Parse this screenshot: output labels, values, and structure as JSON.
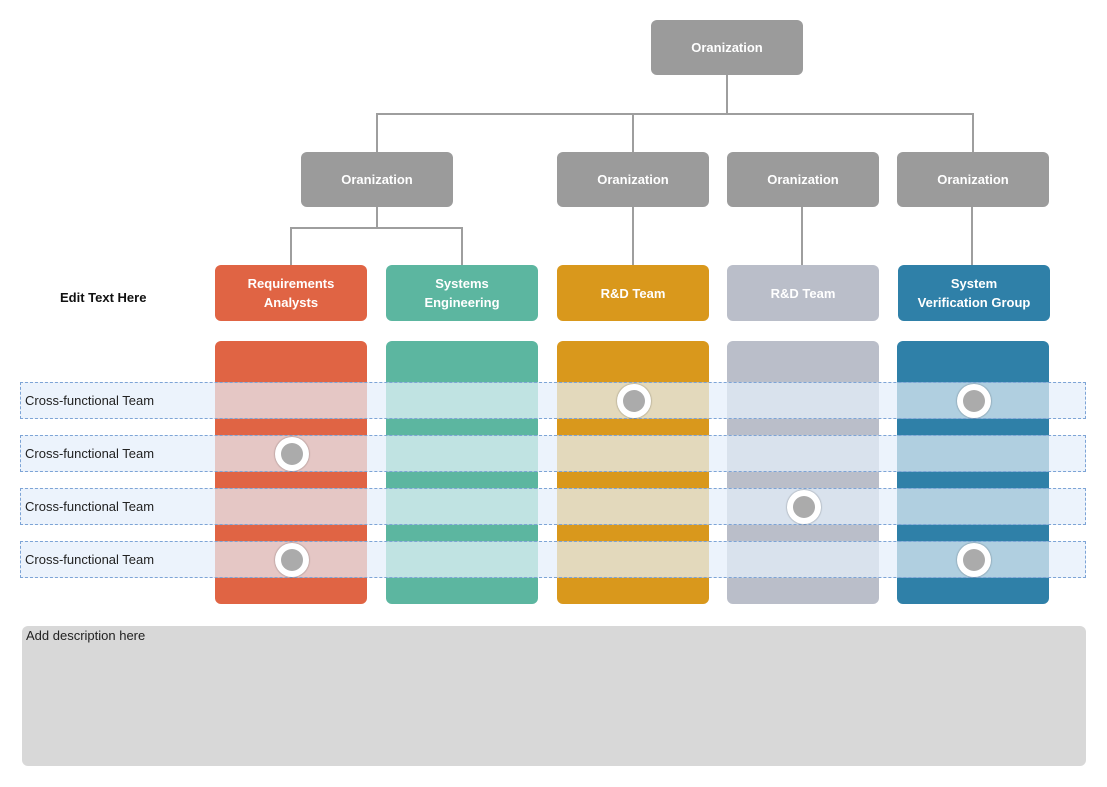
{
  "root": {
    "label": "Oranization"
  },
  "level2": [
    {
      "label": "Oranization"
    },
    {
      "label": "Oranization"
    },
    {
      "label": "Oranization"
    },
    {
      "label": "Oranization"
    }
  ],
  "side_label": "Edit Text Here",
  "teams": [
    {
      "label": "Requirements\nAnalysts",
      "color": "#e06444",
      "tint": "#e5c7c5"
    },
    {
      "label": "Systems\nEngineering",
      "color": "#5cb6a0",
      "tint": "#c0e3e2"
    },
    {
      "label": "R&D Team",
      "color": "#d9981c",
      "tint": "#e3d9bc"
    },
    {
      "label": "R&D Team",
      "color": "#babec9",
      "tint": "#d9e2ed"
    },
    {
      "label": "System\nVerification Group",
      "color": "#2f80a8",
      "tint": "#b0cfe0"
    }
  ],
  "rows": [
    {
      "label": "Cross-functional Team",
      "markers": [
        2,
        4
      ]
    },
    {
      "label": "Cross-functional Team",
      "markers": [
        0
      ]
    },
    {
      "label": "Cross-functional Team",
      "markers": [
        3
      ]
    },
    {
      "label": "Cross-functional Team",
      "markers": [
        0,
        4
      ]
    }
  ],
  "description": "Add description here"
}
